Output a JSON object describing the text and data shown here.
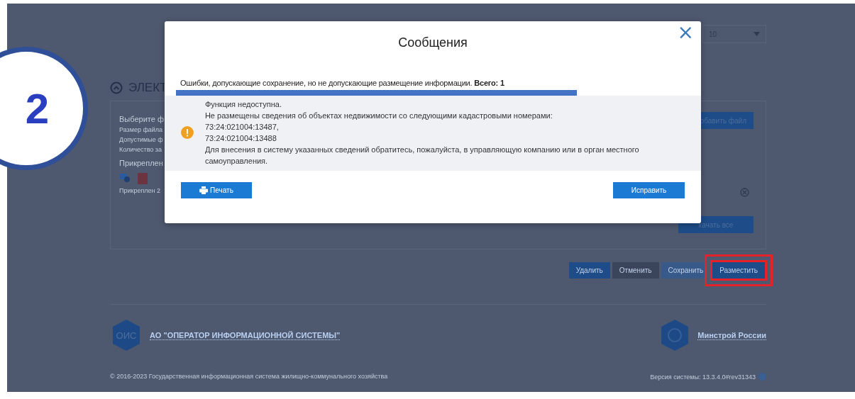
{
  "step_badge": "2",
  "page": {
    "page_size": {
      "value": "10"
    },
    "section": {
      "title": "ЭЛЕКТ",
      "lines": [
        {
          "kind": "heading",
          "text": "Выберите ф"
        },
        {
          "kind": "note",
          "text": "Размер файла"
        },
        {
          "kind": "note",
          "text": "Допустимые ф"
        },
        {
          "kind": "note",
          "text": "Количество за"
        },
        {
          "kind": "heading",
          "text": "Прикреплен"
        }
      ],
      "attached_caption": "Прикреплен 2",
      "add_file_button": "обавить файл",
      "download_all_button": "качать все"
    },
    "actions": [
      {
        "label": "Удалить",
        "kind": "primary",
        "highlighted": false
      },
      {
        "label": "Отменить",
        "kind": "dark",
        "highlighted": false
      },
      {
        "label": "Сохранить",
        "kind": "muted",
        "highlighted": false
      },
      {
        "label": "Разместить",
        "kind": "primary",
        "highlighted": true
      }
    ],
    "footer": {
      "operator_logo": "ОИС",
      "operator_link": "АО \"ОПЕРАТОР ИНФОРМАЦИОННОЙ СИСТЕМЫ\"",
      "ministry_link": "Минстрой России",
      "copyright": "© 2016-2023 Государственная информационная система жилищно-коммунального хозяйства",
      "version": "Версия системы: 13.3.4.0#rev31343"
    }
  },
  "dialog": {
    "title": "Сообщения",
    "close": "×",
    "group_header": "Ошибки, допускающие сохранение, но не допускающие размещение информации.  **Всего: 1**",
    "messages": [
      {
        "lines": [
          "Функция недоступна.",
          "Не размещены сведения об объектах недвижимости со следующими кадастровыми номерами:",
          "73:24:021004:13487,",
          "73:24:021004:13488",
          "Для внесения в систему указанных сведений обратитесь, пожалуйста, в управляющую компанию или в орган местного самоуправления."
        ]
      }
    ],
    "print_button": "Печать",
    "fix_button": "Исправить"
  }
}
